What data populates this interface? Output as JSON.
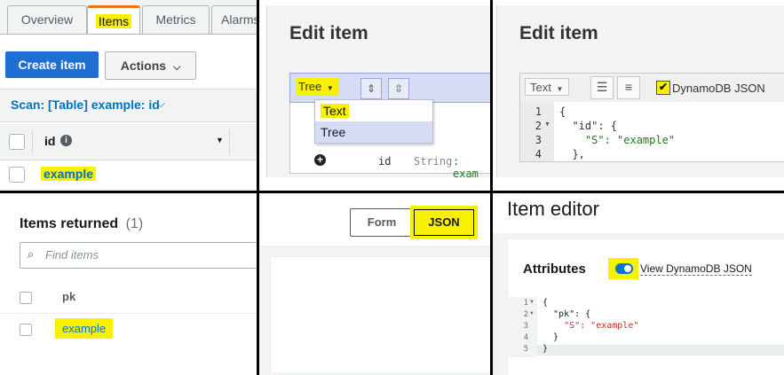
{
  "panel_a": {
    "tabs": [
      "Overview",
      "Items",
      "Metrics",
      "Alarms"
    ],
    "create_button": "Create item",
    "actions_button": "Actions",
    "scan_label": "Scan: [Table] example: id",
    "column_header": "id",
    "row_value": "example"
  },
  "panel_b": {
    "title": "Edit item",
    "view_select": "Tree",
    "menu_items": [
      "Text",
      "Tree"
    ],
    "tree_row": {
      "key": "id",
      "type": "String",
      "value_prefix": ": exam"
    }
  },
  "panel_c": {
    "title": "Edit item",
    "view_select": "Text",
    "checkbox_label": "DynamoDB JSON",
    "line_numbers": [
      "1",
      "2",
      "3",
      "4"
    ],
    "code_lines": [
      "{",
      "  \"id\": {",
      "    \"S\": \"example\"",
      "  },"
    ]
  },
  "panel_d": {
    "heading": "Items returned",
    "count": "(1)",
    "search_placeholder": "Find items",
    "column_header": "pk",
    "row_value": "example"
  },
  "panel_e": {
    "form_label": "Form",
    "json_label": "JSON"
  },
  "panel_f": {
    "heading": "Item editor",
    "attributes_label": "Attributes",
    "toggle_label": "View DynamoDB JSON",
    "line_numbers": [
      "1",
      "2",
      "3",
      "4",
      "5"
    ],
    "code_lines": [
      "{",
      "  \"pk\": {",
      "    \"S\": \"example\"",
      "  }",
      "}"
    ]
  },
  "colors": {
    "highlight": "#f7f100",
    "primary_button": "#1f6ed4",
    "link": "#0073bb",
    "toggle": "#0972d3"
  }
}
